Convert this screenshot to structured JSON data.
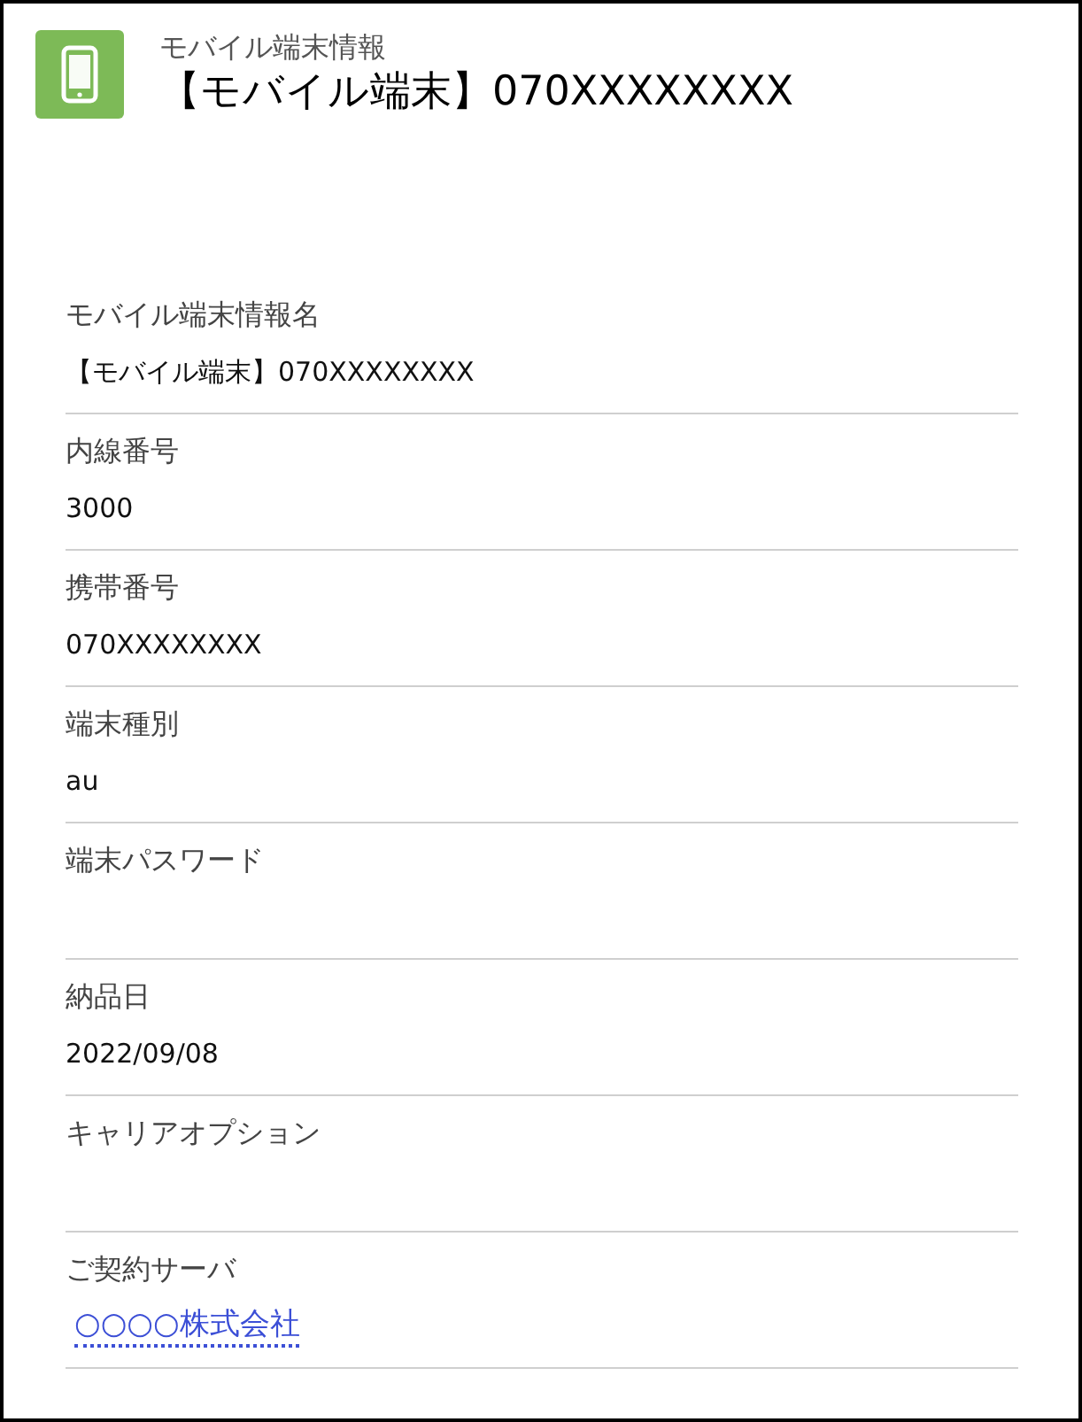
{
  "header": {
    "object_type": "モバイル端末情報",
    "title": "【モバイル端末】070XXXXXXXX"
  },
  "fields": [
    {
      "label": "モバイル端末情報名",
      "value": "【モバイル端末】070XXXXXXXX",
      "kind": "text"
    },
    {
      "label": "内線番号",
      "value": "3000",
      "kind": "text"
    },
    {
      "label": "携帯番号",
      "value": "070XXXXXXXX",
      "kind": "text"
    },
    {
      "label": "端末種別",
      "value": "au",
      "kind": "text"
    },
    {
      "label": "端末パスワード"
    },
    {
      "label": "納品日",
      "value": "2022/09/08",
      "kind": "text"
    },
    {
      "label": "キャリアオプション"
    },
    {
      "label": "ご契約サーバ",
      "value": "○○○○株式会社",
      "kind": "link"
    }
  ]
}
